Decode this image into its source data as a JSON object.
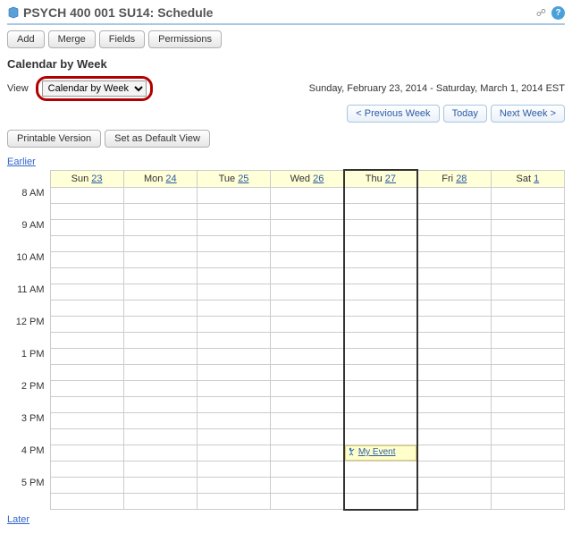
{
  "title": "PSYCH 400 001 SU14: Schedule",
  "toolbar": {
    "add": "Add",
    "merge": "Merge",
    "fields": "Fields",
    "permissions": "Permissions"
  },
  "section_heading": "Calendar by Week",
  "view_label": "View",
  "view_select_value": "Calendar by Week",
  "date_range": "Sunday, February 23, 2014 - Saturday, March 1, 2014 EST",
  "nav": {
    "prev": "< Previous Week",
    "today": "Today",
    "next": "Next Week >"
  },
  "options": {
    "printable": "Printable Version",
    "default_view": "Set as Default View"
  },
  "earlier_label": "Earlier",
  "later_label": "Later",
  "days": [
    {
      "label": "Sun",
      "num": "23"
    },
    {
      "label": "Mon",
      "num": "24"
    },
    {
      "label": "Tue",
      "num": "25"
    },
    {
      "label": "Wed",
      "num": "26"
    },
    {
      "label": "Thu",
      "num": "27",
      "today": true
    },
    {
      "label": "Fri",
      "num": "28"
    },
    {
      "label": "Sat",
      "num": "1"
    }
  ],
  "hours": [
    "8 AM",
    "9 AM",
    "10 AM",
    "11 AM",
    "12 PM",
    "1 PM",
    "2 PM",
    "3 PM",
    "4 PM",
    "5 PM"
  ],
  "event": {
    "title": "My Event",
    "day_index": 4,
    "hour_index": 8
  }
}
